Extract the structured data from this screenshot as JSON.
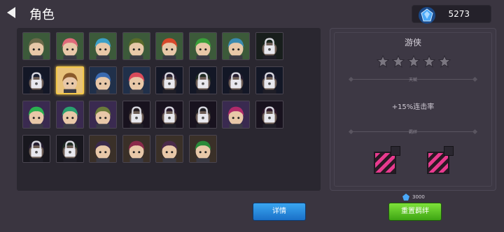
{
  "header": {
    "title": "角色"
  },
  "currency": {
    "icon": "blue-gem-icon",
    "value": "5273"
  },
  "roster": {
    "cells": [
      {
        "kind": "hero",
        "hair": "#6b6a4a",
        "bg": "#3c5a3a"
      },
      {
        "kind": "hero",
        "hair": "#e06a7a",
        "bg": "#3c5a3a"
      },
      {
        "kind": "hero",
        "hair": "#3ca0c8",
        "bg": "#3c5a3a"
      },
      {
        "kind": "hero",
        "hair": "#5a6a2a",
        "bg": "#3c5a3a"
      },
      {
        "kind": "hero",
        "hair": "#d8482a",
        "bg": "#3c5a3a"
      },
      {
        "kind": "hero",
        "hair": "#3aa03a",
        "bg": "#3c5a3a"
      },
      {
        "kind": "hero",
        "hair": "#3a8ab0",
        "bg": "#3c5a3a"
      },
      {
        "kind": "locked",
        "hair": "#2a4a2a",
        "bg": "#2a3a2a"
      },
      {
        "kind": "locked",
        "hair": "#2a3a5a",
        "bg": "#202a40"
      },
      {
        "kind": "hero",
        "hair": "#8a5a2a",
        "bg": "#e8c27a",
        "selected": true
      },
      {
        "kind": "hero",
        "hair": "#3a6ab0",
        "bg": "#20304a"
      },
      {
        "kind": "hero",
        "hair": "#d84a5a",
        "bg": "#20304a"
      },
      {
        "kind": "locked",
        "hair": "#4a3a5a",
        "bg": "#202a40"
      },
      {
        "kind": "locked",
        "hair": "#3a5a3a",
        "bg": "#202a40"
      },
      {
        "kind": "locked",
        "hair": "#4a3a5a",
        "bg": "#202a40"
      },
      {
        "kind": "locked",
        "hair": "#3a3a5a",
        "bg": "#202a40"
      },
      {
        "kind": "hero",
        "hair": "#2ab050",
        "bg": "#3a2a50"
      },
      {
        "kind": "hero",
        "hair": "#2aa070",
        "bg": "#3a2a50"
      },
      {
        "kind": "hero",
        "hair": "#6a7a3a",
        "bg": "#3a2a50"
      },
      {
        "kind": "locked",
        "hair": "#4a3a3a",
        "bg": "#2a2030"
      },
      {
        "kind": "locked",
        "hair": "#4a2a4a",
        "bg": "#2a2030"
      },
      {
        "kind": "locked",
        "hair": "#3a3a3a",
        "bg": "#2a2030"
      },
      {
        "kind": "hero",
        "hair": "#b02a6a",
        "bg": "#3a2a50"
      },
      {
        "kind": "locked",
        "hair": "#5a2a4a",
        "bg": "#2a2030"
      },
      {
        "kind": "locked",
        "hair": "#4a3a5a",
        "bg": "#2a2a30"
      },
      {
        "kind": "locked",
        "hair": "#3a5a3a",
        "bg": "#2a2a30"
      },
      {
        "kind": "hero",
        "hair": "#3a2a4a",
        "bg": "#3a3028"
      },
      {
        "kind": "hero",
        "hair": "#8a2a4a",
        "bg": "#3a3028"
      },
      {
        "kind": "hero",
        "hair": "#4a2a4a",
        "bg": "#3a3028"
      },
      {
        "kind": "hero",
        "hair": "#2a8a3a",
        "bg": "#3a3028"
      }
    ]
  },
  "detail": {
    "class_name": "游侠",
    "stars_total": 5,
    "stars_filled": 0,
    "talent_label": "天赋",
    "bonus_text": "+15%连击率",
    "bond_label": "羁绊",
    "bond_count": 2
  },
  "actions": {
    "detail_label": "详情",
    "reset_label": "重置羁绊",
    "reset_cost": "3000",
    "reset_cost_icon": "blue-gem-icon"
  }
}
